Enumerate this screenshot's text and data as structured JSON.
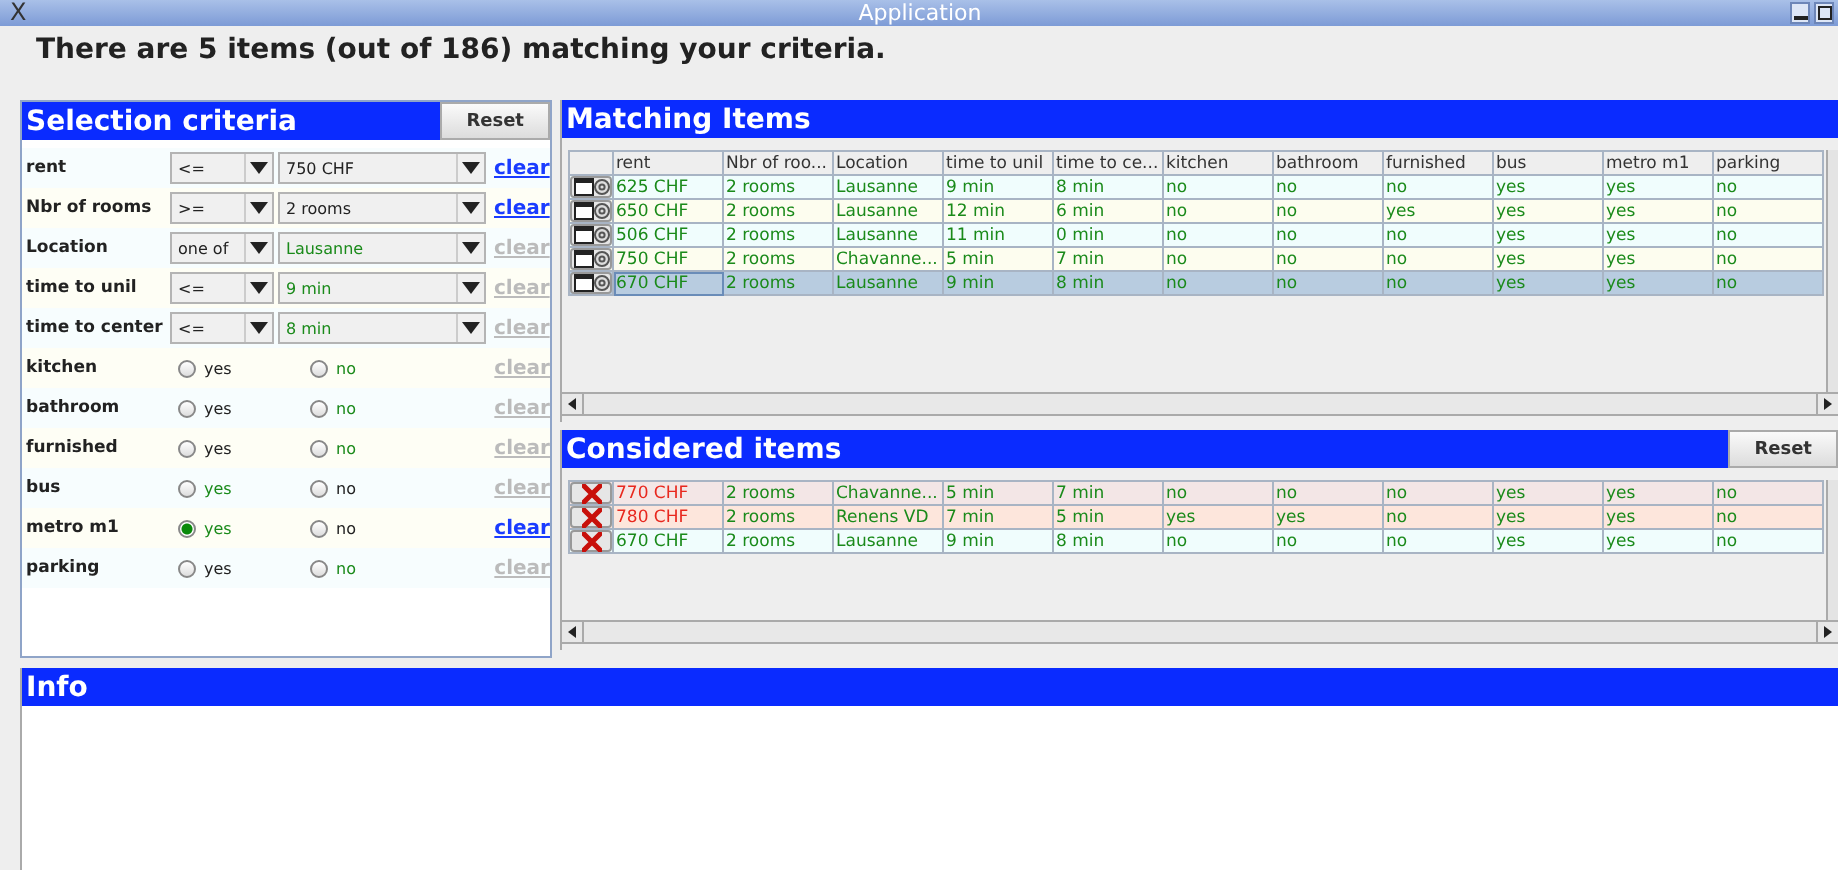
{
  "window": {
    "title": "Application",
    "logo": "X"
  },
  "summary": "There are 5 items (out of 186) matching your criteria.",
  "criteria": {
    "title": "Selection criteria",
    "reset": "Reset",
    "rows": [
      {
        "kind": "dropdown",
        "label": "rent",
        "operator": "<=",
        "value": "750 CHF",
        "matched": false,
        "clear": "clear",
        "clear_active": true
      },
      {
        "kind": "dropdown",
        "label": "Nbr of rooms",
        "operator": ">=",
        "value": "2 rooms",
        "matched": false,
        "clear": "clear",
        "clear_active": true
      },
      {
        "kind": "dropdown",
        "label": "Location",
        "operator": "one of",
        "value": "Lausanne",
        "matched": true,
        "clear": "clear",
        "clear_active": false
      },
      {
        "kind": "dropdown",
        "label": "time to unil",
        "operator": "<=",
        "value": "9 min",
        "matched": true,
        "clear": "clear",
        "clear_active": false
      },
      {
        "kind": "dropdown",
        "label": "time to center",
        "operator": "<=",
        "value": "8 min",
        "matched": true,
        "clear": "clear",
        "clear_active": false
      },
      {
        "kind": "radio",
        "label": "kitchen",
        "options": [
          {
            "label": "yes",
            "selected": false,
            "matched": false
          },
          {
            "label": "no",
            "selected": false,
            "matched": true
          }
        ],
        "clear": "clear",
        "clear_active": false
      },
      {
        "kind": "radio",
        "label": "bathroom",
        "options": [
          {
            "label": "yes",
            "selected": false,
            "matched": false
          },
          {
            "label": "no",
            "selected": false,
            "matched": true
          }
        ],
        "clear": "clear",
        "clear_active": false
      },
      {
        "kind": "radio",
        "label": "furnished",
        "options": [
          {
            "label": "yes",
            "selected": false,
            "matched": false
          },
          {
            "label": "no",
            "selected": false,
            "matched": true
          }
        ],
        "clear": "clear",
        "clear_active": false
      },
      {
        "kind": "radio",
        "label": "bus",
        "options": [
          {
            "label": "yes",
            "selected": false,
            "matched": true
          },
          {
            "label": "no",
            "selected": false,
            "matched": false
          }
        ],
        "clear": "clear",
        "clear_active": false
      },
      {
        "kind": "radio",
        "label": "metro m1",
        "options": [
          {
            "label": "yes",
            "selected": true,
            "matched": true
          },
          {
            "label": "no",
            "selected": false,
            "matched": false
          }
        ],
        "clear": "clear",
        "clear_active": true
      },
      {
        "kind": "radio",
        "label": "parking",
        "options": [
          {
            "label": "yes",
            "selected": false,
            "matched": false
          },
          {
            "label": "no",
            "selected": false,
            "matched": true
          }
        ],
        "clear": "clear",
        "clear_active": false
      }
    ]
  },
  "matching": {
    "title": "Matching Items",
    "columns": [
      "rent",
      "Nbr of roo...",
      "Location",
      "time to unil",
      "time to ce...",
      "kitchen",
      "bathroom",
      "furnished",
      "bus",
      "metro m1",
      "parking"
    ],
    "rows": [
      {
        "selected": false,
        "cells": [
          "625 CHF",
          "2 rooms",
          "Lausanne",
          "9 min",
          "8 min",
          "no",
          "no",
          "no",
          "yes",
          "yes",
          "no"
        ]
      },
      {
        "selected": false,
        "cells": [
          "650 CHF",
          "2 rooms",
          "Lausanne",
          "12 min",
          "6 min",
          "no",
          "no",
          "yes",
          "yes",
          "yes",
          "no"
        ]
      },
      {
        "selected": false,
        "cells": [
          "506 CHF",
          "2 rooms",
          "Lausanne",
          "11 min",
          "0 min",
          "no",
          "no",
          "no",
          "yes",
          "yes",
          "no"
        ]
      },
      {
        "selected": false,
        "cells": [
          "750 CHF",
          "2 rooms",
          "Chavanne...",
          "5 min",
          "7 min",
          "no",
          "no",
          "no",
          "yes",
          "yes",
          "no"
        ]
      },
      {
        "selected": true,
        "cells": [
          "670 CHF",
          "2 rooms",
          "Lausanne",
          "9 min",
          "8 min",
          "no",
          "no",
          "no",
          "yes",
          "yes",
          "no"
        ]
      }
    ]
  },
  "considered": {
    "title": "Considered items",
    "reset": "Reset",
    "rows": [
      {
        "color": "#f3e6e6",
        "over_budget": true,
        "cells": [
          "770 CHF",
          "2 rooms",
          "Chavanne...",
          "5 min",
          "7 min",
          "no",
          "no",
          "no",
          "yes",
          "yes",
          "no"
        ]
      },
      {
        "color": "#fde6dc",
        "over_budget": true,
        "cells": [
          "780 CHF",
          "2 rooms",
          "Renens VD",
          "7 min",
          "5 min",
          "yes",
          "yes",
          "no",
          "yes",
          "yes",
          "no"
        ]
      },
      {
        "color": "#f0fdfd",
        "over_budget": false,
        "cells": [
          "670 CHF",
          "2 rooms",
          "Lausanne",
          "9 min",
          "8 min",
          "no",
          "no",
          "no",
          "yes",
          "yes",
          "no"
        ]
      }
    ]
  },
  "info": {
    "title": "Info"
  }
}
